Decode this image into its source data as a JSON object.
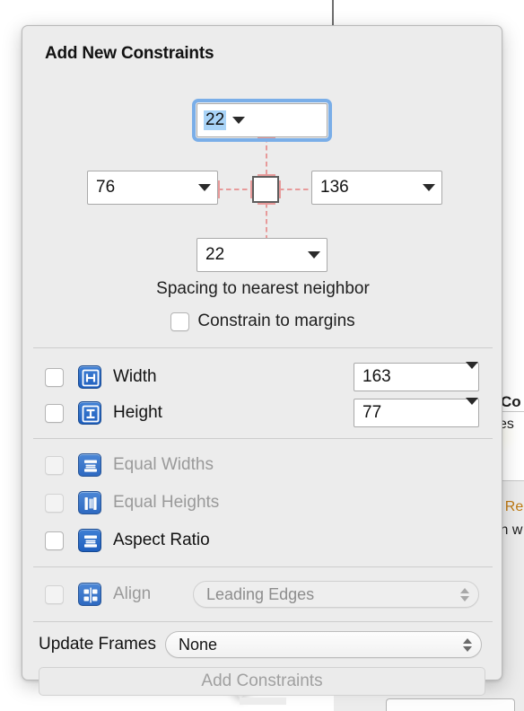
{
  "popover": {
    "title": "Add New Constraints",
    "spacing": {
      "top": {
        "value": "22",
        "selected": true
      },
      "left": {
        "value": "76"
      },
      "right": {
        "value": "136"
      },
      "bottom": {
        "value": "22"
      },
      "caption": "Spacing to nearest neighbor"
    },
    "margins": {
      "label": "Constrain to margins",
      "checked": false
    },
    "constraints": [
      {
        "key": "width",
        "icon": "width-constraint-icon",
        "label": "Width",
        "checked": false,
        "enabled": true,
        "value": "163"
      },
      {
        "key": "height",
        "icon": "height-constraint-icon",
        "label": "Height",
        "checked": false,
        "enabled": true,
        "value": "77"
      },
      {
        "key": "eqw",
        "icon": "equal-widths-icon",
        "label": "Equal Widths",
        "checked": false,
        "enabled": false
      },
      {
        "key": "eqh",
        "icon": "equal-heights-icon",
        "label": "Equal Heights",
        "checked": false,
        "enabled": false
      },
      {
        "key": "ar",
        "icon": "aspect-ratio-icon",
        "label": "Aspect Ratio",
        "checked": false,
        "enabled": true
      }
    ],
    "align": {
      "icon": "align-icon",
      "label": "Align",
      "checked": false,
      "enabled": false,
      "selected_option": "Leading Edges"
    },
    "update_frames": {
      "label": "Update Frames",
      "selected_option": "None"
    },
    "add_button": {
      "label": "Add Constraints",
      "enabled": false
    }
  },
  "background": {
    "fragment_1": "Co",
    "fragment_2": "es",
    "fragment_3": "· Re",
    "fragment_4": "in w"
  },
  "colors": {
    "popover_bg": "#ececec",
    "accent_blue": "#2f6fca",
    "focus_ring": "#7aaee8",
    "selection": "#a8d3f7",
    "spacing_guide": "#e79a9a",
    "disabled_text": "#9a9a9a"
  }
}
